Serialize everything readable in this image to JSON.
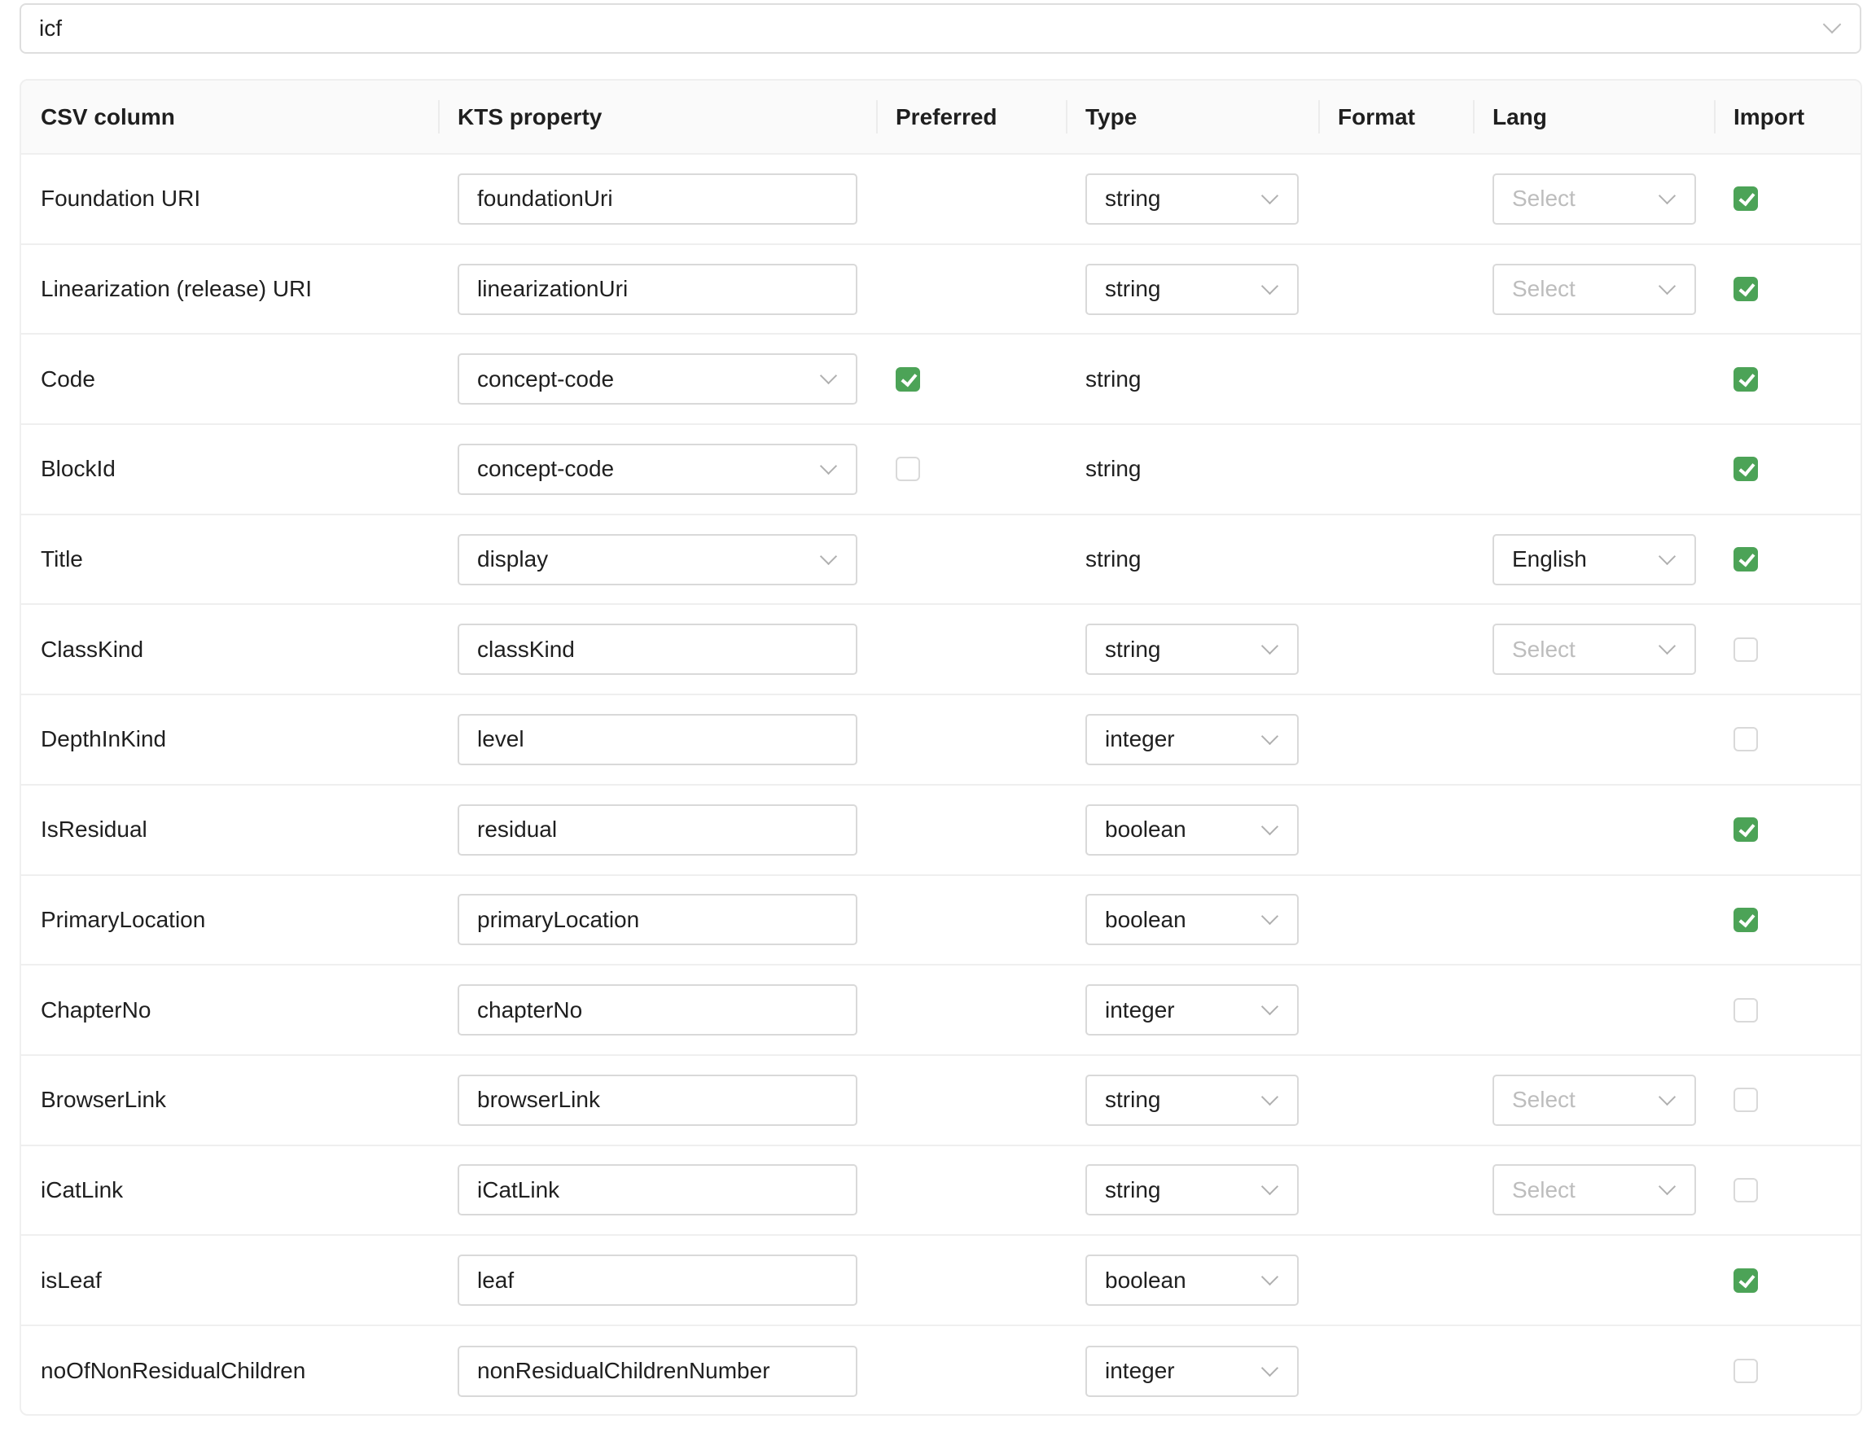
{
  "dataset_select": {
    "value": "icf"
  },
  "columns": [
    "CSV column",
    "KTS property",
    "Preferred",
    "Type",
    "Format",
    "Lang",
    "Import"
  ],
  "colors": {
    "checked": "#4ca357",
    "border": "#d9d9d9"
  },
  "rows": [
    {
      "csv": "Foundation URI",
      "kts": "foundationUri",
      "kts_kind": "input",
      "preferred": null,
      "type": "string",
      "type_kind": "select",
      "lang": "Select",
      "lang_placeholder": true,
      "import": true
    },
    {
      "csv": "Linearization (release) URI",
      "kts": "linearizationUri",
      "kts_kind": "input",
      "preferred": null,
      "type": "string",
      "type_kind": "select",
      "lang": "Select",
      "lang_placeholder": true,
      "import": true
    },
    {
      "csv": "Code",
      "kts": "concept-code",
      "kts_kind": "select",
      "preferred": true,
      "type": "string",
      "type_kind": "text",
      "lang": null,
      "import": true
    },
    {
      "csv": "BlockId",
      "kts": "concept-code",
      "kts_kind": "select",
      "preferred": false,
      "type": "string",
      "type_kind": "text",
      "lang": null,
      "import": true
    },
    {
      "csv": "Title",
      "kts": "display",
      "kts_kind": "select",
      "preferred": null,
      "type": "string",
      "type_kind": "text",
      "lang": "English",
      "lang_placeholder": false,
      "import": true
    },
    {
      "csv": "ClassKind",
      "kts": "classKind",
      "kts_kind": "input",
      "preferred": null,
      "type": "string",
      "type_kind": "select",
      "lang": "Select",
      "lang_placeholder": true,
      "import": false
    },
    {
      "csv": "DepthInKind",
      "kts": "level",
      "kts_kind": "input",
      "preferred": null,
      "type": "integer",
      "type_kind": "select",
      "lang": null,
      "import": false
    },
    {
      "csv": "IsResidual",
      "kts": "residual",
      "kts_kind": "input",
      "preferred": null,
      "type": "boolean",
      "type_kind": "select",
      "lang": null,
      "import": true
    },
    {
      "csv": "PrimaryLocation",
      "kts": "primaryLocation",
      "kts_kind": "input",
      "preferred": null,
      "type": "boolean",
      "type_kind": "select",
      "lang": null,
      "import": true
    },
    {
      "csv": "ChapterNo",
      "kts": "chapterNo",
      "kts_kind": "input",
      "preferred": null,
      "type": "integer",
      "type_kind": "select",
      "lang": null,
      "import": false
    },
    {
      "csv": "BrowserLink",
      "kts": "browserLink",
      "kts_kind": "input",
      "preferred": null,
      "type": "string",
      "type_kind": "select",
      "lang": "Select",
      "lang_placeholder": true,
      "import": false
    },
    {
      "csv": "iCatLink",
      "kts": "iCatLink",
      "kts_kind": "input",
      "preferred": null,
      "type": "string",
      "type_kind": "select",
      "lang": "Select",
      "lang_placeholder": true,
      "import": false
    },
    {
      "csv": "isLeaf",
      "kts": "leaf",
      "kts_kind": "input",
      "preferred": null,
      "type": "boolean",
      "type_kind": "select",
      "lang": null,
      "import": true
    },
    {
      "csv": "noOfNonResidualChildren",
      "kts": "nonResidualChildrenNumber",
      "kts_kind": "input",
      "preferred": null,
      "type": "integer",
      "type_kind": "select",
      "lang": null,
      "import": false
    }
  ]
}
